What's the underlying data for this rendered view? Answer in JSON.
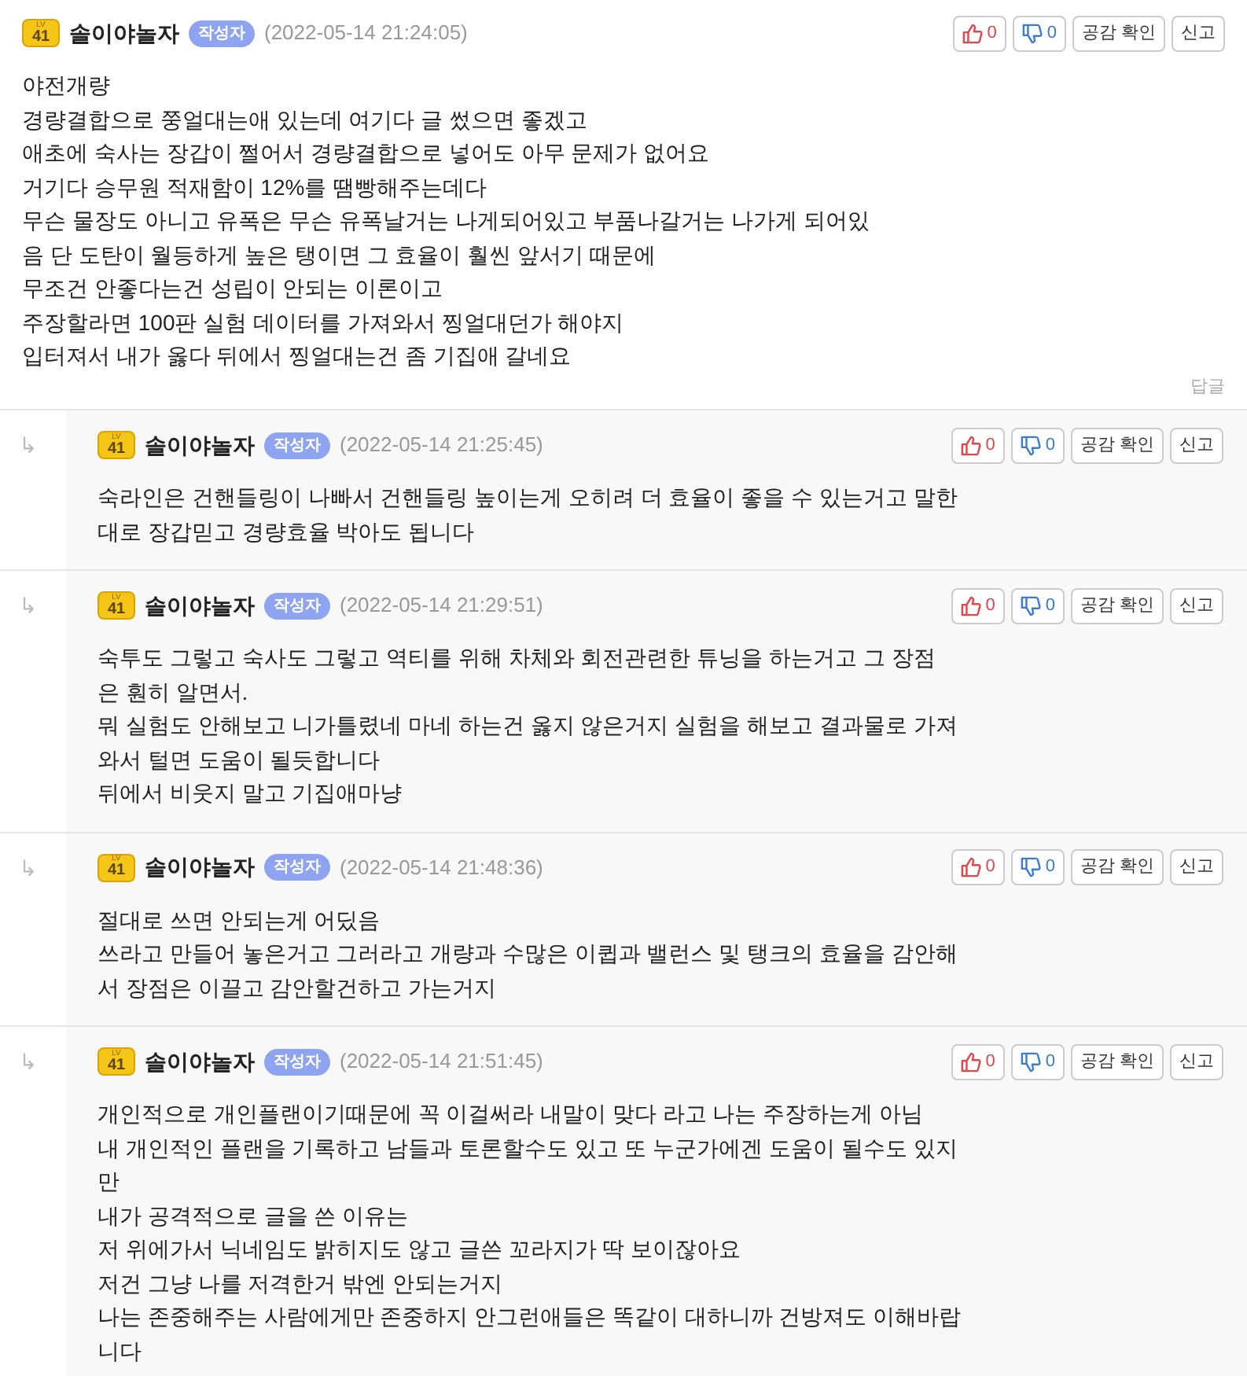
{
  "comments": [
    {
      "kind": "comment",
      "author": "솔이야놀자",
      "rank_label": "LV",
      "rank": "41",
      "badge": "작성자",
      "date": "(2022-05-14 21:24:05)",
      "likes": "0",
      "dislikes": "0",
      "check_label": "공감 확인",
      "report_label": "신고",
      "lines": [
        "야전개량",
        "경량결합으로 쭝얼대는애 있는데 여기다 글 썼으면 좋겠고",
        "애초에 숙사는 장갑이 쩔어서 경량결합으로 넣어도 아무 문제가 없어요",
        "거기다 승무원 적재함이 12%를 땜빵해주는데다",
        "무슨 물장도 아니고 유폭은 무슨 유폭날거는 나게되어있고 부품나갈거는 나가게 되어있",
        "음 단 도탄이 월등하게 높은 탱이면 그 효율이 훨씬 앞서기 때문에",
        "무조건 안좋다는건 성립이 안되는 이론이고",
        "주장할라면 100판 실험 데이터를 가져와서 찡얼대던가 해야지",
        "입터져서 내가 옳다 뒤에서 찡얼대는건 좀 기집애 갈네요"
      ],
      "reply_label": "답글"
    },
    {
      "kind": "reply",
      "arrow": "↳",
      "author": "솔이야놀자",
      "rank_label": "LV",
      "rank": "41",
      "badge": "작성자",
      "date": "(2022-05-14 21:25:45)",
      "likes": "0",
      "dislikes": "0",
      "check_label": "공감 확인",
      "report_label": "신고",
      "lines": [
        "숙라인은 건핸들링이 나빠서 건핸들링 높이는게 오히려 더 효율이 좋을 수 있는거고 말한",
        "대로 장갑믿고 경량효율 박아도 됩니다"
      ]
    },
    {
      "kind": "reply",
      "arrow": "↳",
      "author": "솔이야놀자",
      "rank_label": "LV",
      "rank": "41",
      "badge": "작성자",
      "date": "(2022-05-14 21:29:51)",
      "likes": "0",
      "dislikes": "0",
      "check_label": "공감 확인",
      "report_label": "신고",
      "lines": [
        "숙투도 그렇고 숙사도 그렇고 역티를 위해 차체와 회전관련한 튜닝을 하는거고 그 장점",
        "은 훤히 알면서.",
        "뭐 실험도 안해보고 니가틀렸네 마네 하는건 옳지 않은거지 실험을 해보고 결과물로 가져",
        "와서 털면 도움이 될듯합니다",
        "뒤에서 비웃지 말고 기집애마냥"
      ]
    },
    {
      "kind": "reply",
      "arrow": "↳",
      "author": "솔이야놀자",
      "rank_label": "LV",
      "rank": "41",
      "badge": "작성자",
      "date": "(2022-05-14 21:48:36)",
      "likes": "0",
      "dislikes": "0",
      "check_label": "공감 확인",
      "report_label": "신고",
      "lines": [
        "절대로 쓰면 안되는게 어딨음",
        "쓰라고 만들어 놓은거고 그러라고 개량과 수많은 이큅과 밸런스 및 탱크의 효율을 감안해",
        "서 장점은 이끌고 감안할건하고 가는거지"
      ]
    },
    {
      "kind": "reply",
      "arrow": "↳",
      "author": "솔이야놀자",
      "rank_label": "LV",
      "rank": "41",
      "badge": "작성자",
      "date": "(2022-05-14 21:51:45)",
      "likes": "0",
      "dislikes": "0",
      "check_label": "공감 확인",
      "report_label": "신고",
      "lines": [
        "개인적으로 개인플랜이기때문에 꼭 이걸써라 내말이 맞다 라고 나는 주장하는게 아님",
        "내 개인적인 플랜을 기록하고 남들과 토론할수도 있고 또 누군가에겐 도움이 될수도 있지",
        "만",
        "내가 공격적으로 글을 쓴 이유는",
        "저 위에가서 닉네임도 밝히지도 않고 글쓴 꼬라지가 딱 보이잖아요",
        "저건 그냥 나를 저격한거 밖엔 안되는거지",
        "나는 존중해주는 사람에게만 존중하지 안그런애들은 똑같이 대하니까 건방져도 이해바랍",
        "니다"
      ]
    }
  ]
}
